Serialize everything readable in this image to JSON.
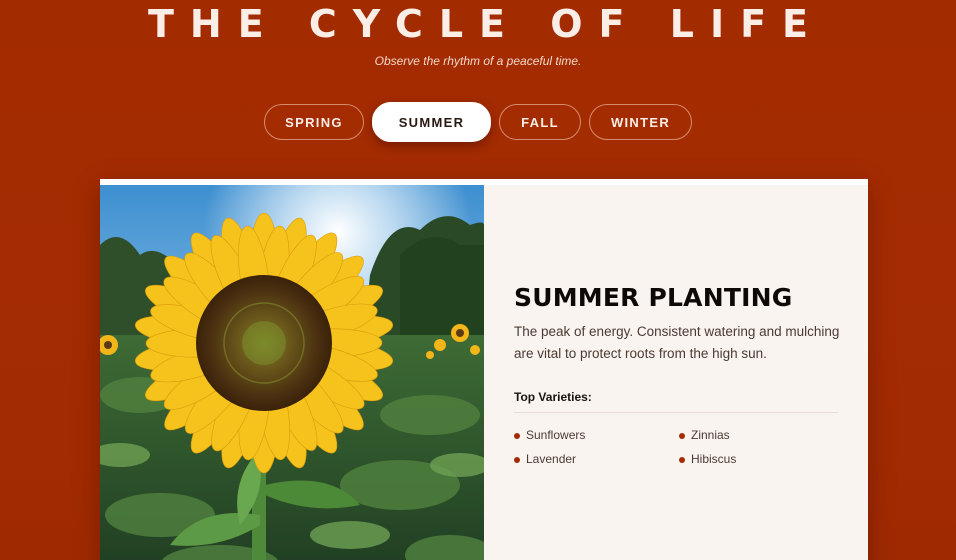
{
  "header": {
    "title": "THE CYCLE OF LIFE",
    "subtitle": "Observe the rhythm of a peaceful time."
  },
  "tabs": [
    {
      "label": "SPRING",
      "active": false
    },
    {
      "label": "SUMMER",
      "active": true
    },
    {
      "label": "FALL",
      "active": false
    },
    {
      "label": "WINTER",
      "active": false
    }
  ],
  "card": {
    "image_subject": "sunflower-field",
    "heading": "SUMMER PLANTING",
    "description": "The peak of energy. Consistent watering and mulching are vital to protect roots from the high sun.",
    "varieties_label": "Top Varieties:",
    "varieties": [
      "Sunflowers",
      "Zinnias",
      "Lavender",
      "Hibiscus"
    ]
  },
  "colors": {
    "background": "#a32b00",
    "accent": "#a32b00",
    "card": "#faf4f0",
    "active_tab": "#ffffff"
  }
}
